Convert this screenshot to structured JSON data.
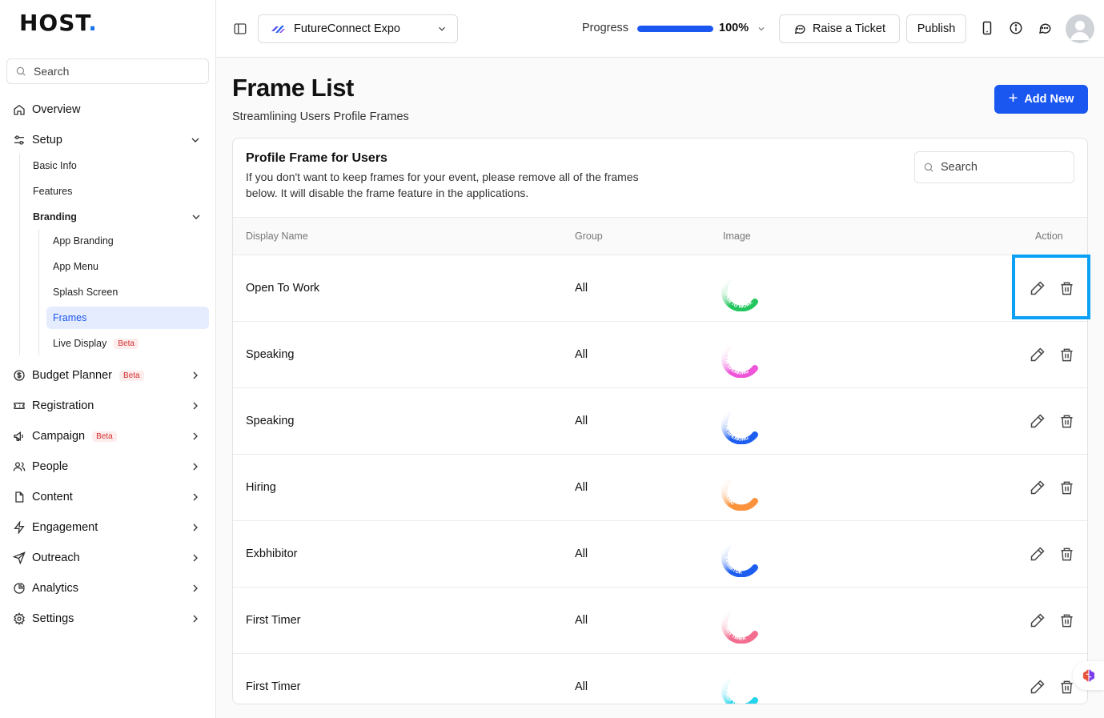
{
  "sidebar": {
    "logo": "HOST",
    "logo_dot": ".",
    "search_placeholder": "Search",
    "items": {
      "overview": "Overview",
      "setup": "Setup",
      "basic_info": "Basic Info",
      "features": "Features",
      "branding": "Branding",
      "app_branding": "App Branding",
      "app_menu": "App Menu",
      "splash_screen": "Splash Screen",
      "frames": "Frames",
      "live_display": "Live Display",
      "budget_planner": "Budget Planner",
      "registration": "Registration",
      "campaign": "Campaign",
      "people": "People",
      "content": "Content",
      "engagement": "Engagement",
      "outreach": "Outreach",
      "analytics": "Analytics",
      "settings": "Settings"
    },
    "beta_label": "Beta"
  },
  "topbar": {
    "event_name": "FutureConnect Expo",
    "progress_label": "Progress",
    "progress_value": 100,
    "progress_text": "100%",
    "raise_ticket": "Raise a Ticket",
    "publish": "Publish"
  },
  "page": {
    "title": "Frame List",
    "subtitle": "Streamlining Users Profile Frames",
    "add_new": "Add New"
  },
  "card": {
    "title": "Profile Frame for Users",
    "description": "If you don't want to keep frames for your event, please remove all of the frames below. It will disable the frame feature in the applications.",
    "search_placeholder": "Search",
    "columns": [
      "Display Name",
      "Group",
      "Image",
      "Action"
    ],
    "rows": [
      {
        "name": "Open To Work",
        "group": "All",
        "color": "#22c55e",
        "ring_text": "OPEN TO WORK"
      },
      {
        "name": "Speaking",
        "group": "All",
        "color": "#ee55d8",
        "ring_text": "I'M SPEAKING"
      },
      {
        "name": "Speaking",
        "group": "All",
        "color": "#1d5ef0",
        "ring_text": "I'M SPEAKING"
      },
      {
        "name": "Hiring",
        "group": "All",
        "color": "#fb923c",
        "ring_text": "HIRING"
      },
      {
        "name": "Exbhibitor",
        "group": "All",
        "color": "#1d5ef0",
        "ring_text": "EXHIBITOR"
      },
      {
        "name": "First Timer",
        "group": "All",
        "color": "#f26d8f",
        "ring_text": "FIRST TIMER"
      },
      {
        "name": "First Timer",
        "group": "All",
        "color": "#22d3ee",
        "ring_text": "FIRST TIMER"
      }
    ]
  },
  "colors": {
    "accent": "#1a56f0",
    "highlight": "#0aa0f5",
    "beta": "#d32f2f"
  }
}
